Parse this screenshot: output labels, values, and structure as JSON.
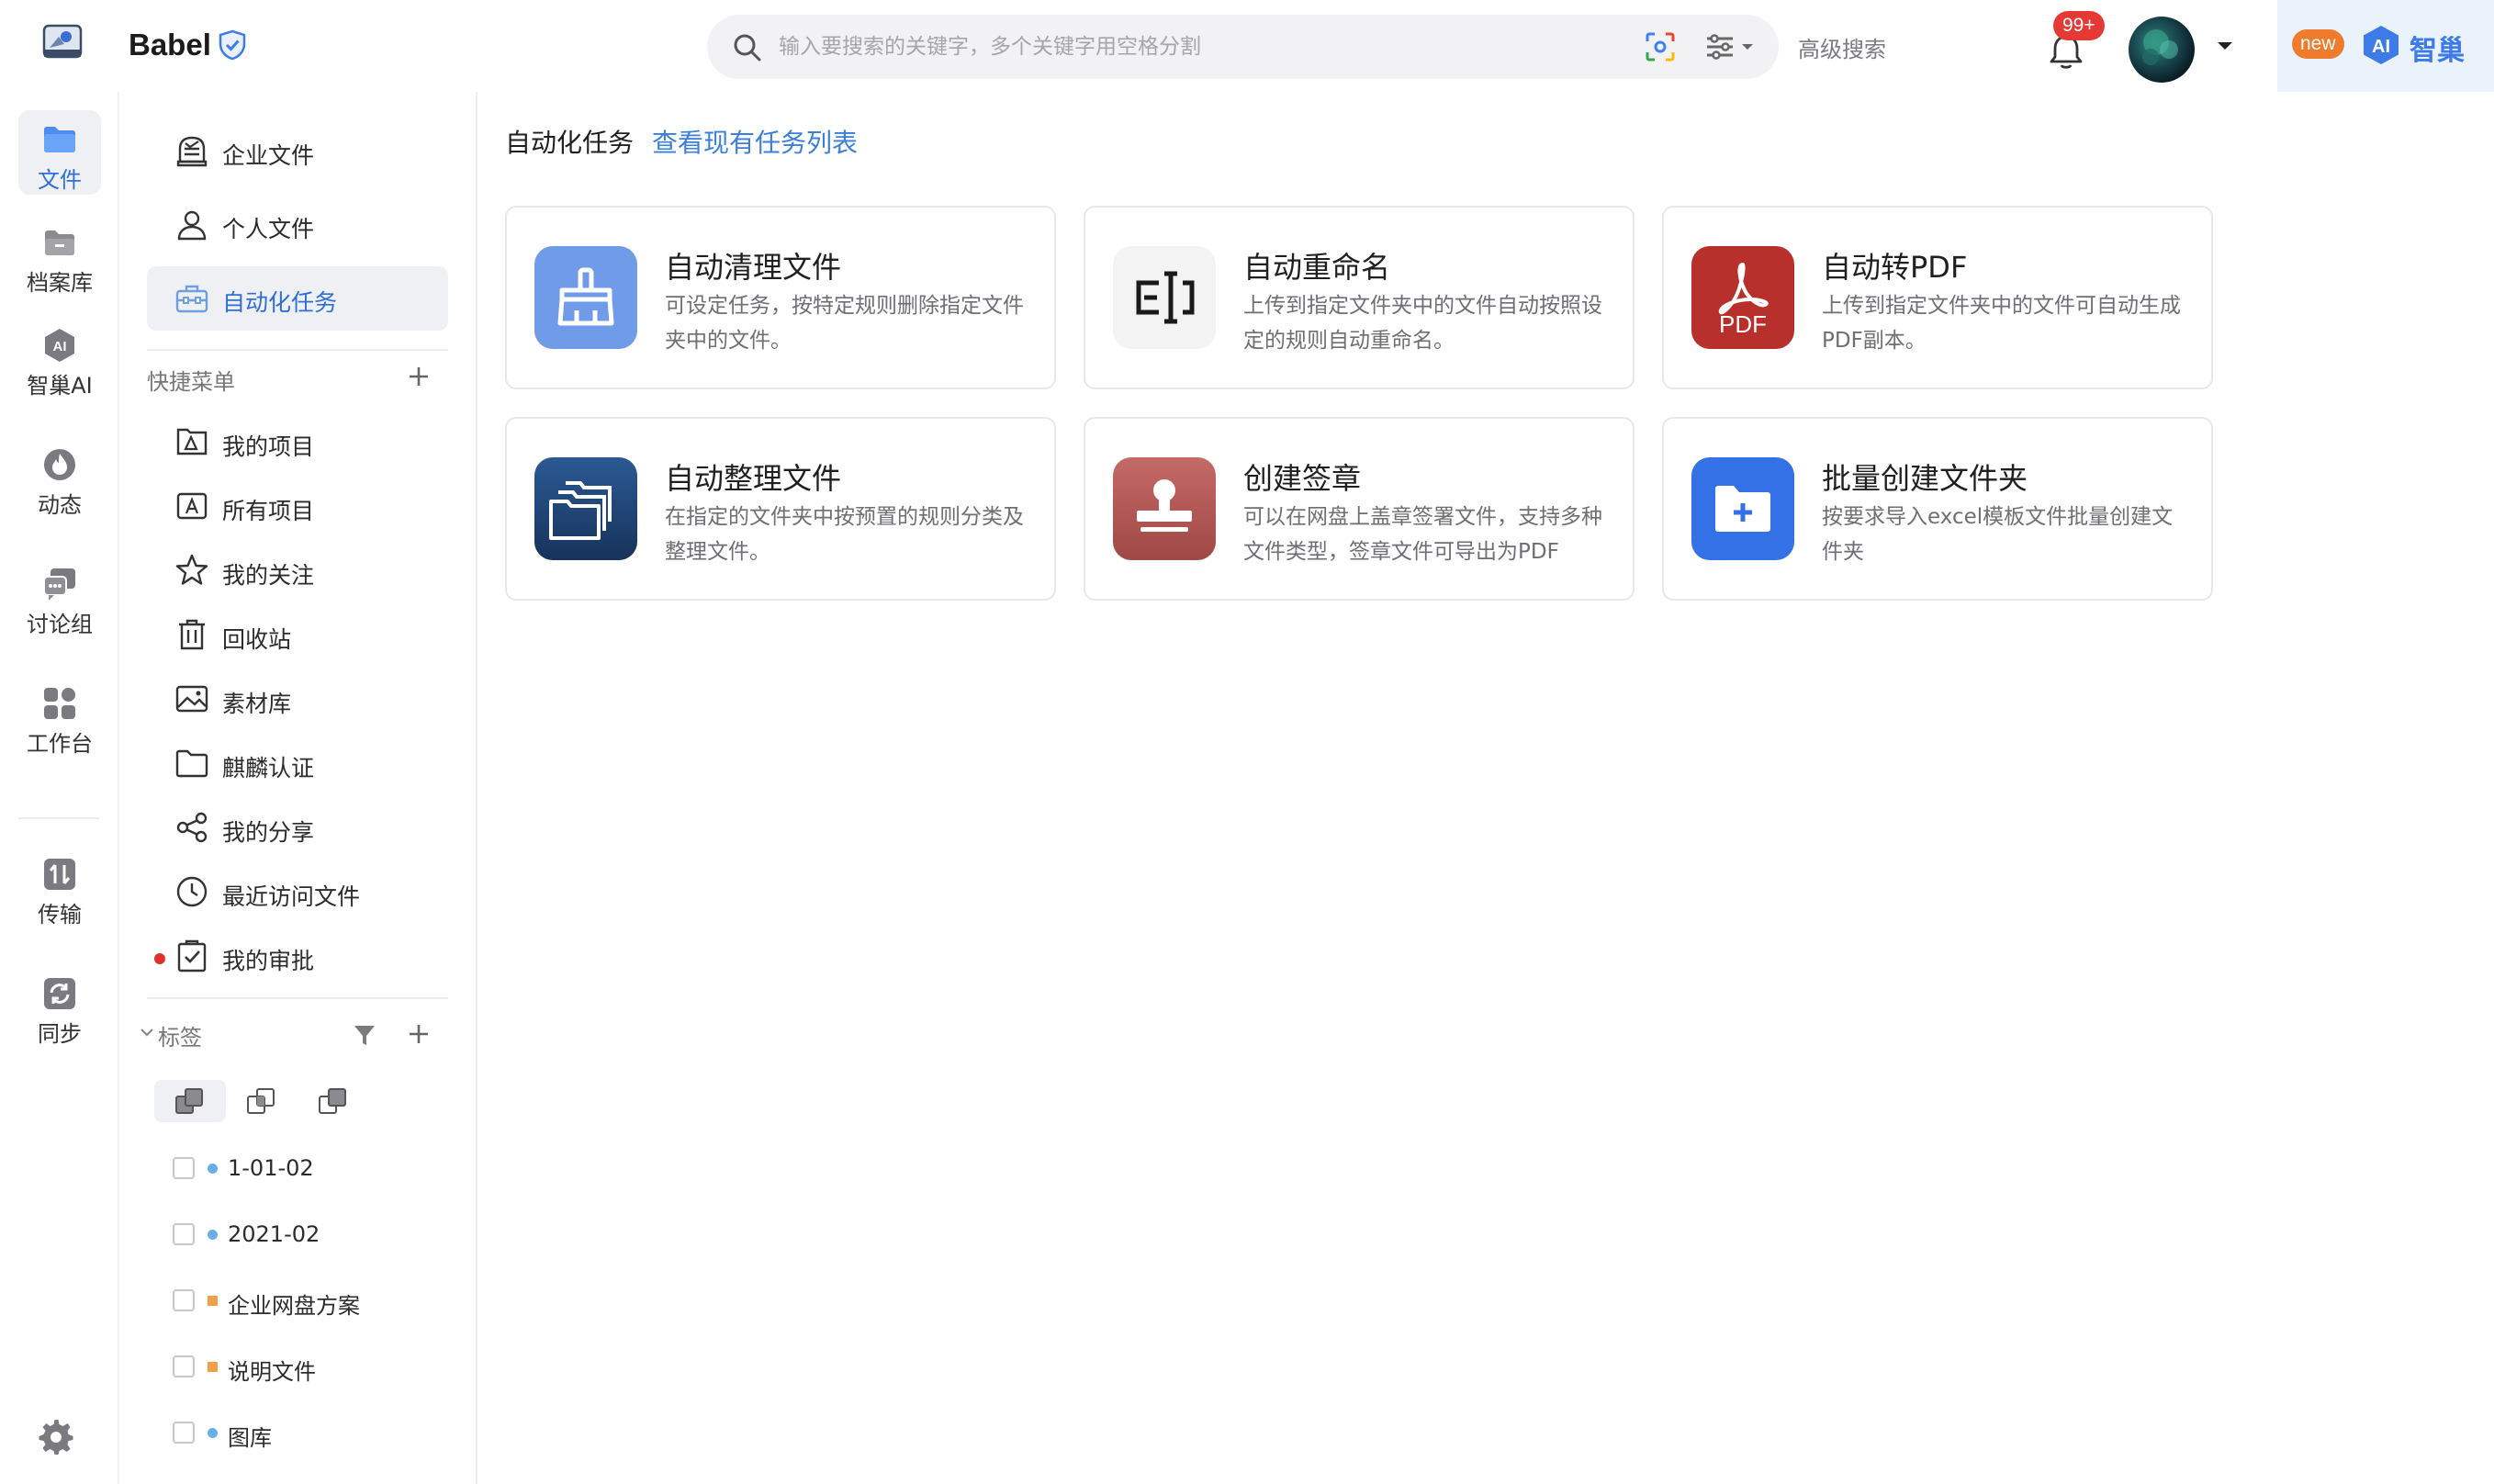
{
  "app": {
    "brand": "Babel"
  },
  "search": {
    "placeholder": "输入要搜索的关键字，多个关键字用空格分割",
    "advanced_label": "高级搜索"
  },
  "notifications": {
    "badge": "99+"
  },
  "ai_promo": {
    "new_label": "new",
    "label": "智巢"
  },
  "rail": {
    "items": [
      {
        "label": "文件",
        "icon": "folder-icon",
        "active": true
      },
      {
        "label": "档案库",
        "icon": "archive-icon"
      },
      {
        "label": "智巢AI",
        "icon": "ai-icon"
      },
      {
        "label": "动态",
        "icon": "flame-icon"
      },
      {
        "label": "讨论组",
        "icon": "chat-icon"
      },
      {
        "label": "工作台",
        "icon": "apps-icon"
      },
      {
        "label": "传输",
        "icon": "transfer-icon"
      },
      {
        "label": "同步",
        "icon": "sync-icon"
      }
    ]
  },
  "sidebar": {
    "nav": [
      {
        "label": "企业文件",
        "icon": "enterprise-drive-icon"
      },
      {
        "label": "个人文件",
        "icon": "person-icon"
      },
      {
        "label": "自动化任务",
        "icon": "toolbox-icon",
        "active": true
      }
    ],
    "quick_menu_title": "快捷菜单",
    "quick_menu": [
      {
        "label": "我的项目",
        "icon": "my-project-icon"
      },
      {
        "label": "所有项目",
        "icon": "all-projects-icon"
      },
      {
        "label": "我的关注",
        "icon": "star-icon"
      },
      {
        "label": "回收站",
        "icon": "trash-icon"
      },
      {
        "label": "素材库",
        "icon": "image-icon"
      },
      {
        "label": "麒麟认证",
        "icon": "folder-outline-icon"
      },
      {
        "label": "我的分享",
        "icon": "share-icon"
      },
      {
        "label": "最近访问文件",
        "icon": "clock-icon"
      },
      {
        "label": "我的审批",
        "icon": "approval-icon",
        "has_alert": true
      }
    ],
    "tags_title": "标签",
    "tags": [
      {
        "label": "1-01-02",
        "color": "#6aaee6",
        "shape": "dot"
      },
      {
        "label": "2021-02",
        "color": "#6aaee6",
        "shape": "dot"
      },
      {
        "label": "企业网盘方案",
        "color": "#f0a04b",
        "shape": "square"
      },
      {
        "label": "说明文件",
        "color": "#f0a04b",
        "shape": "square"
      },
      {
        "label": "图库",
        "color": "#6aaee6",
        "shape": "dot"
      }
    ]
  },
  "main": {
    "title": "自动化任务",
    "link": "查看现有任务列表",
    "cards": [
      {
        "title": "自动清理文件",
        "desc": "可设定任务，按特定规则删除指定文件夹中的文件。",
        "icon": "broom-icon",
        "color": "#6f9be8"
      },
      {
        "title": "自动重命名",
        "desc": "上传到指定文件夹中的文件自动按照设定的规则自动重命名。",
        "icon": "rename-icon",
        "color": "#f3f3f3"
      },
      {
        "title": "自动转PDF",
        "desc": "上传到指定文件夹中的文件可自动生成PDF副本。",
        "icon": "pdf-icon",
        "color": "#b8302b"
      },
      {
        "title": "自动整理文件",
        "desc": "在指定的文件夹中按预置的规则分类及整理文件。",
        "icon": "folders-icon",
        "color": "#1f3f6e"
      },
      {
        "title": "创建签章",
        "desc": "可以在网盘上盖章签署文件，支持多种文件类型，签章文件可导出为PDF",
        "icon": "stamp-icon",
        "color": "#b35a58"
      },
      {
        "title": "批量创建文件夹",
        "desc": "按要求导入excel模板文件批量创建文件夹",
        "icon": "folder-add-icon",
        "color": "#3470e6"
      }
    ]
  }
}
